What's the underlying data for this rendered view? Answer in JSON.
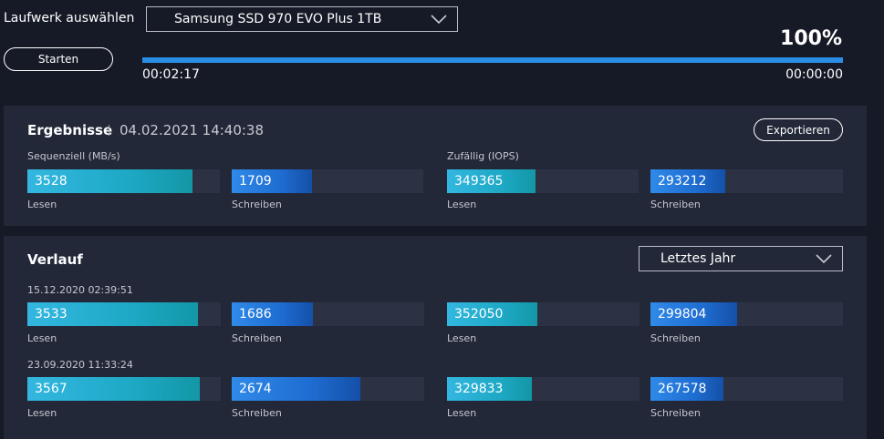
{
  "header": {
    "drive_label": "Laufwerk auswählen",
    "drive_value": "Samsung SSD 970 EVO Plus 1TB",
    "start_button": "Starten",
    "progress_percent": "100%",
    "progress_fraction": 1.0,
    "elapsed": "00:02:17",
    "remaining": "00:00:00"
  },
  "results": {
    "title": "Ergebnisse",
    "timestamp": "04.02.2021 14:40:38",
    "export_button": "Exportieren",
    "sequential_label": "Sequenziell (MB/s)",
    "random_label": "Zufällig (IOPS)",
    "read_label": "Lesen",
    "write_label": "Schreiben",
    "seq_read": "3528",
    "seq_read_fraction": 0.86,
    "seq_write": "1709",
    "seq_write_fraction": 0.42,
    "rand_read": "349365",
    "rand_read_fraction": 0.46,
    "rand_write": "293212",
    "rand_write_fraction": 0.39
  },
  "history": {
    "title": "Verlauf",
    "period_select": "Letztes Jahr",
    "read_label": "Lesen",
    "write_label": "Schreiben",
    "entries": [
      {
        "date": "15.12.2020 02:39:51",
        "seq_read": "3533",
        "seq_read_fraction": 0.88,
        "seq_write": "1686",
        "seq_write_fraction": 0.42,
        "rand_read": "352050",
        "rand_read_fraction": 0.47,
        "rand_write": "299804",
        "rand_write_fraction": 0.45
      },
      {
        "date": "23.09.2020 11:33:24",
        "seq_read": "3567",
        "seq_read_fraction": 0.89,
        "seq_write": "2674",
        "seq_write_fraction": 0.67,
        "rand_read": "329833",
        "rand_read_fraction": 0.44,
        "rand_write": "267578",
        "rand_write_fraction": 0.38
      }
    ]
  },
  "colors": {
    "background": "#161a26",
    "panel": "#232838",
    "progress": "#2b8ee6",
    "read_bar": "#22aed0",
    "write_bar": "#2176dc"
  }
}
